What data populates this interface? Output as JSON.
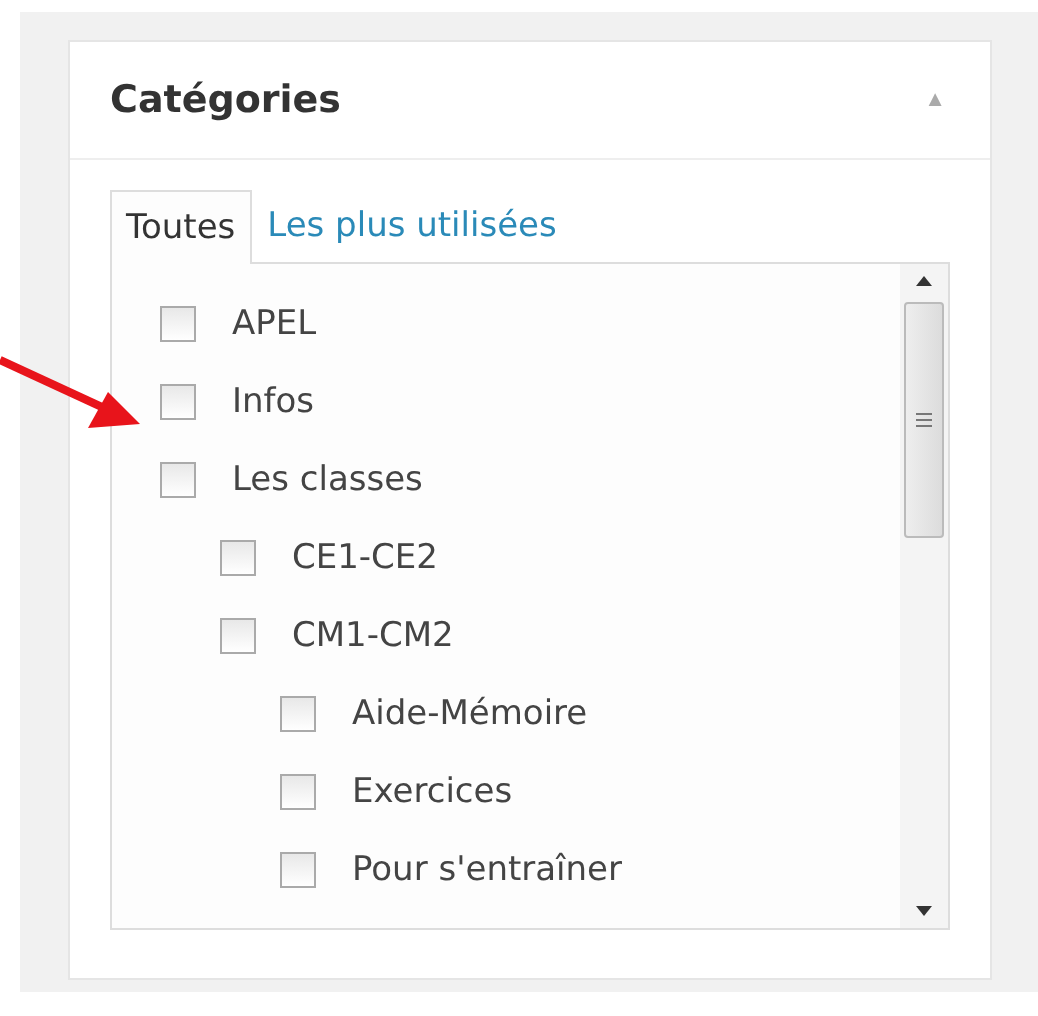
{
  "panel": {
    "title": "Catégories",
    "collapse_icon": "▲"
  },
  "tabs": [
    {
      "label": "Toutes",
      "selected": true
    },
    {
      "label": "Les plus utilisées",
      "selected": false
    }
  ],
  "categories": [
    {
      "label": "APEL",
      "checked": false
    },
    {
      "label": "Infos",
      "checked": false
    },
    {
      "label": "Les classes",
      "checked": false,
      "children": [
        {
          "label": "CE1-CE2",
          "checked": false
        },
        {
          "label": "CM1-CM2",
          "checked": false,
          "children": [
            {
              "label": "Aide-Mémoire",
              "checked": false
            },
            {
              "label": "Exercices",
              "checked": false
            },
            {
              "label": "Pour s'entraîner",
              "checked": false
            }
          ]
        }
      ]
    }
  ]
}
